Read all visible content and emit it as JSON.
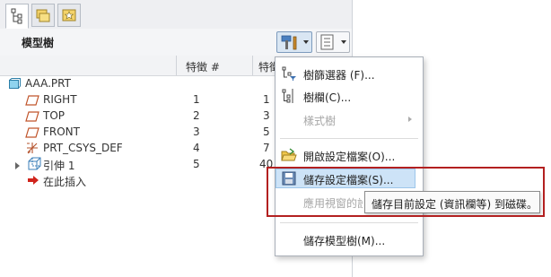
{
  "panel": {
    "title": "模型樹"
  },
  "columns": {
    "col1": "特徵 #",
    "col2": "特徵"
  },
  "tree": {
    "root": "AAA.PRT",
    "rows": [
      {
        "label": "RIGHT",
        "num1": "1",
        "num2": "1"
      },
      {
        "label": "TOP",
        "num1": "2",
        "num2": "3"
      },
      {
        "label": "FRONT",
        "num1": "3",
        "num2": "5"
      },
      {
        "label": "PRT_CSYS_DEF",
        "num1": "4",
        "num2": "7"
      },
      {
        "label": "引伸 1",
        "num1": "5",
        "num2": "40"
      },
      {
        "label": "在此插入",
        "num1": "",
        "num2": ""
      }
    ]
  },
  "menu": {
    "items": [
      {
        "label": "樹篩選器 (F)..."
      },
      {
        "label": "樹欄(C)..."
      },
      {
        "label": "樣式樹"
      },
      {
        "label": "開啟設定檔案(O)..."
      },
      {
        "label": "儲存設定檔案(S)..."
      },
      {
        "label": "應用視窗的設"
      },
      {
        "label": "儲存模型樹(M)..."
      }
    ]
  },
  "tooltip": {
    "text": "儲存目前設定 (資訊欄等) 到磁碟。"
  },
  "colors": {
    "highlight": "#cde3f7",
    "redbox": "#b32020",
    "selected_tab": "#ffffff"
  }
}
